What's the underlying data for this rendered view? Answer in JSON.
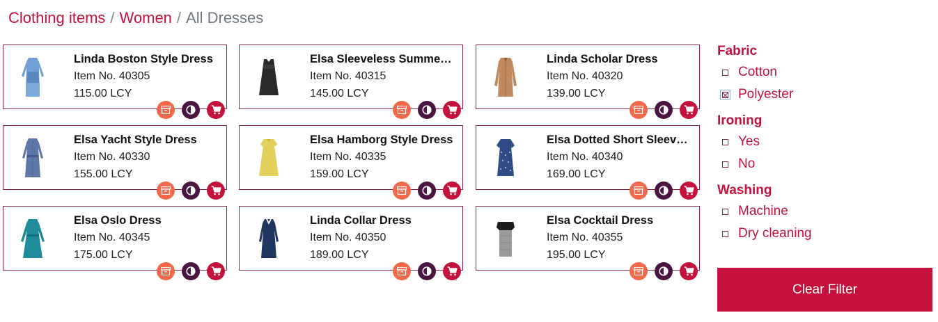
{
  "breadcrumb": {
    "items": [
      "Clothing items",
      "Women"
    ],
    "separator": "/",
    "current": "All Dresses"
  },
  "colors": {
    "accent": "#c4123c",
    "archive_action": "#f26a4b",
    "compare_action": "#4a1540",
    "cart_action": "#c4123c",
    "card_border": "#8b2252"
  },
  "products": [
    {
      "name": "Linda Boston Style Dress",
      "item_no": "Item No. 40305",
      "price": "115.00 LCY",
      "dress_icon": "light-blue-long-sleeve-dress-icon"
    },
    {
      "name": "Elsa Sleeveless Summer ...",
      "item_no": "Item No. 40315",
      "price": "145.00 LCY",
      "dress_icon": "black-sleeveless-dress-icon"
    },
    {
      "name": "Linda Scholar Dress",
      "item_no": "Item No. 40320",
      "price": "139.00 LCY",
      "dress_icon": "tan-coat-dress-icon"
    },
    {
      "name": "Elsa Yacht Style Dress",
      "item_no": "Item No. 40330",
      "price": "155.00 LCY",
      "dress_icon": "blue-shirt-dress-icon"
    },
    {
      "name": "Elsa Hamborg Style Dress",
      "item_no": "Item No. 40335",
      "price": "159.00 LCY",
      "dress_icon": "yellow-dress-icon"
    },
    {
      "name": "Elsa Dotted Short Sleeve ...",
      "item_no": "Item No. 40340",
      "price": "169.00 LCY",
      "dress_icon": "navy-dotted-dress-icon"
    },
    {
      "name": "Elsa Oslo Dress",
      "item_no": "Item No. 40345",
      "price": "175.00 LCY",
      "dress_icon": "teal-dress-icon"
    },
    {
      "name": "Linda Collar Dress",
      "item_no": "Item No. 40350",
      "price": "189.00 LCY",
      "dress_icon": "navy-collar-dress-icon"
    },
    {
      "name": "Elsa Cocktail Dress",
      "item_no": "Item No. 40355",
      "price": "195.00 LCY",
      "dress_icon": "grey-cocktail-dress-icon"
    }
  ],
  "card_actions": [
    "archive-icon",
    "compare-icon",
    "cart-icon"
  ],
  "filters": [
    {
      "title": "Fabric",
      "options": [
        {
          "label": "Cotton",
          "checked": false
        },
        {
          "label": "Polyester",
          "checked": true
        }
      ]
    },
    {
      "title": "Ironing",
      "options": [
        {
          "label": "Yes",
          "checked": false
        },
        {
          "label": "No",
          "checked": false
        }
      ]
    },
    {
      "title": "Washing",
      "options": [
        {
          "label": "Machine",
          "checked": false
        },
        {
          "label": "Dry cleaning",
          "checked": false
        }
      ]
    }
  ],
  "clear_filter_label": "Clear Filter"
}
